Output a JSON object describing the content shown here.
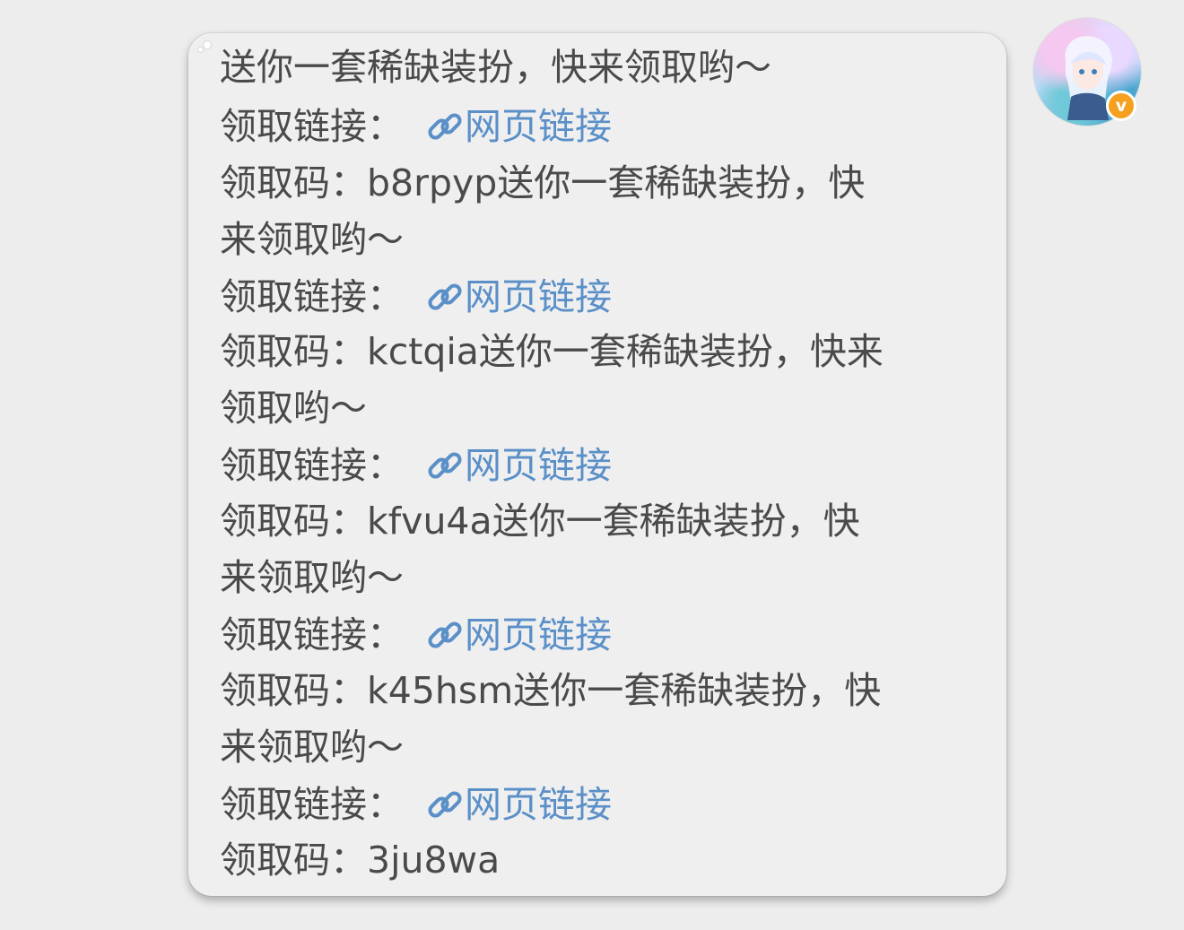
{
  "chat": {
    "message": {
      "lines": [
        {
          "text": "送你一套稀缺装扮，快来领取哟～"
        },
        {
          "prefix": "领取链接：",
          "link": "网页链接"
        },
        {
          "text": "领取码：b8rpyp送你一套稀缺装扮，快"
        },
        {
          "text": "来领取哟～"
        },
        {
          "prefix": "领取链接：",
          "link": "网页链接"
        },
        {
          "text": "领取码：kctqia送你一套稀缺装扮，快来"
        },
        {
          "text": "领取哟～"
        },
        {
          "prefix": "领取链接：",
          "link": "网页链接"
        },
        {
          "text": "领取码：kfvu4a送你一套稀缺装扮，快"
        },
        {
          "text": "来领取哟～"
        },
        {
          "prefix": "领取链接：",
          "link": "网页链接"
        },
        {
          "text": "领取码：k45hsm送你一套稀缺装扮，快"
        },
        {
          "text": "来领取哟～"
        },
        {
          "prefix": "领取链接：",
          "link": "网页链接"
        },
        {
          "text": "领取码：3ju8wa"
        }
      ]
    },
    "avatar": {
      "badge": "v",
      "icon": "anime-avatar-icon"
    },
    "colors": {
      "background": "#ededed",
      "bubble": "#efeff0",
      "text": "#4a4a4a",
      "link": "#5a8fc7",
      "badge": "#f6a020"
    }
  }
}
